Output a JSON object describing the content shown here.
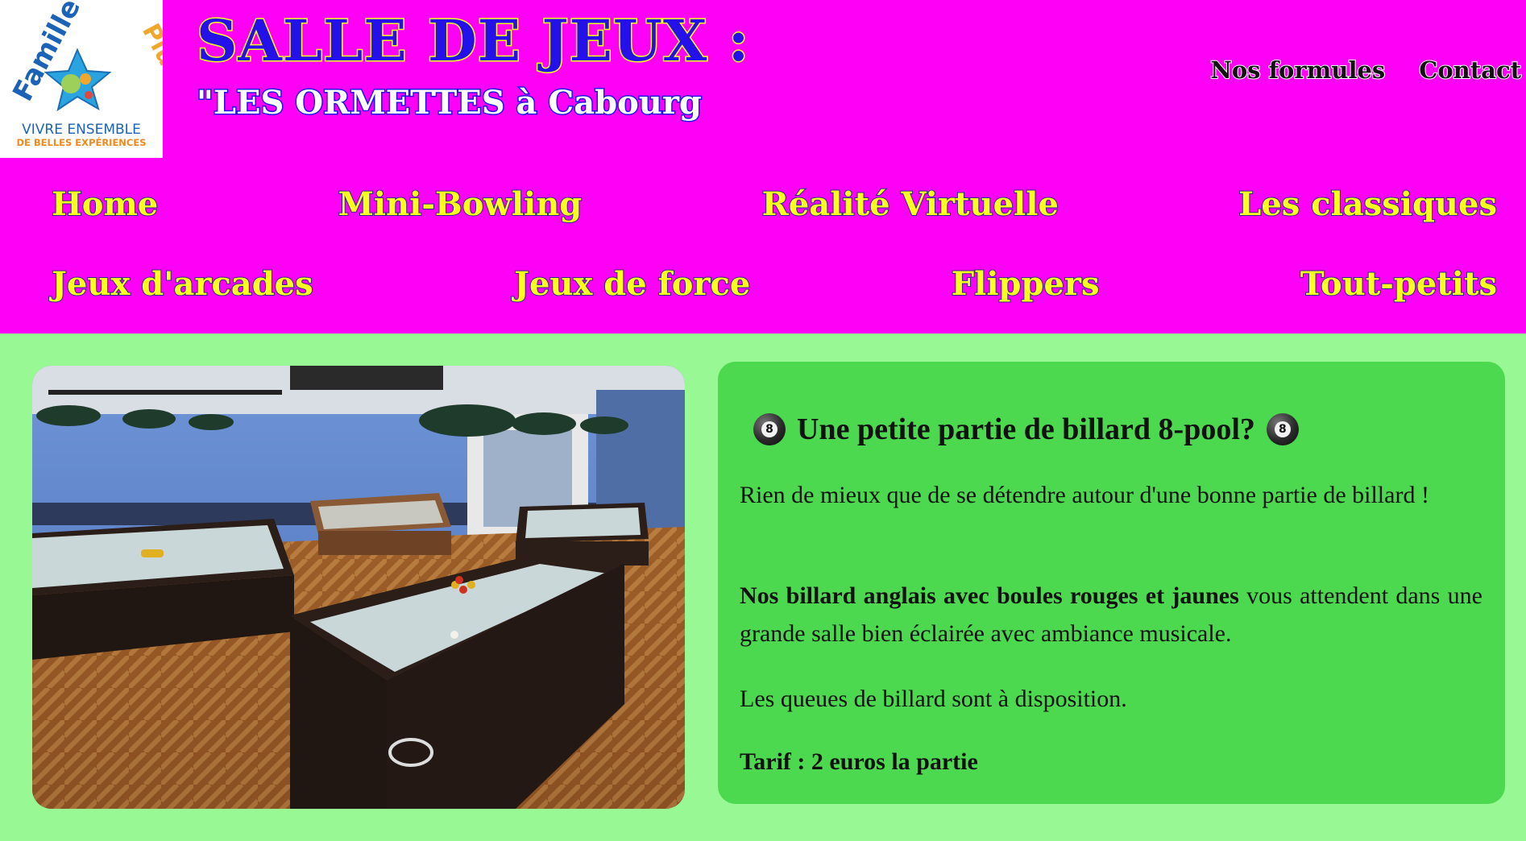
{
  "header": {
    "logo": {
      "line1": "Famille",
      "line2": "Plus",
      "tagline1": "VIVRE ENSEMBLE",
      "tagline2": "DE BELLES EXPÉRIENCES"
    },
    "title": "SALLE DE JEUX :",
    "subtitle": "\"LES ORMETTES à Cabourg",
    "top_links": [
      "Nos formules",
      "Contact"
    ]
  },
  "nav": {
    "row1": [
      "Home",
      "Mini-Bowling",
      "Réalité Virtuelle",
      "Les classiques"
    ],
    "row2": [
      "Jeux d'arcades",
      "Jeux de force",
      "Flippers",
      "Tout-petits"
    ]
  },
  "card": {
    "title": "Une petite partie de billard 8-pool?",
    "ball_number": "8",
    "p1": "Rien de mieux que de se détendre autour d'une bonne partie de billard !",
    "p2_bold": "Nos billard anglais avec boules rouges et jaunes",
    "p2_rest": " vous attendent dans une grande salle bien éclairée avec ambiance musicale.",
    "p3": "Les queues de billard sont à disposition.",
    "p4": "Tarif : 2 euros la partie"
  },
  "colors": {
    "header_bg": "#ff00f6",
    "page_bg": "#98f893",
    "card_bg": "#4cd84f",
    "title_blue": "#2410e8",
    "nav_yellow": "#ffff1e"
  }
}
